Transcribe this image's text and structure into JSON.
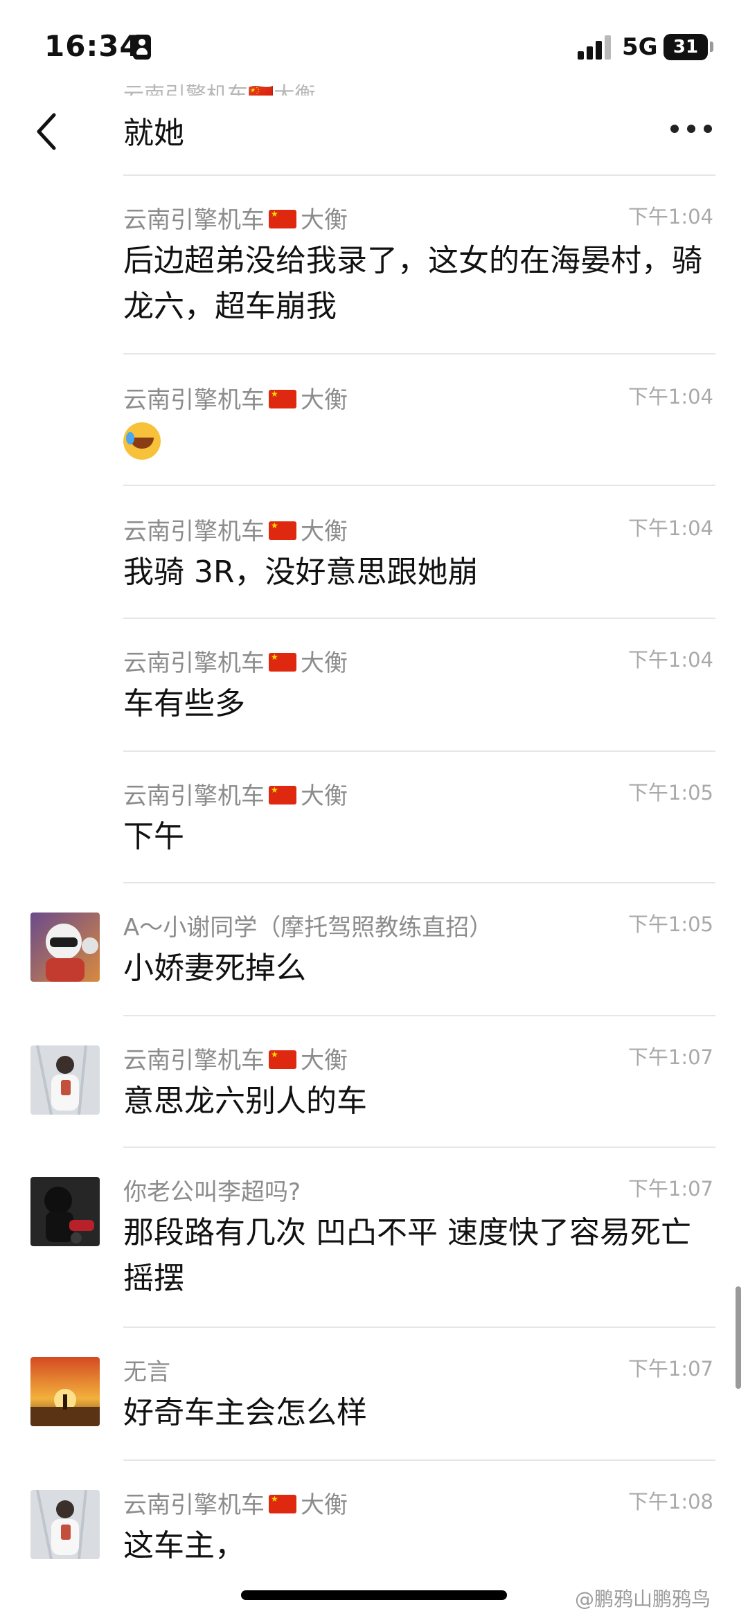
{
  "status_bar": {
    "time": "16:34",
    "network": "5G",
    "battery": "31",
    "icons": [
      "person-badge-icon",
      "signal-icon",
      "battery-icon"
    ]
  },
  "header": {
    "partial_previous": "云南引擎机车🇨🇳大衡",
    "title": "就她",
    "back_icon": "chevron-left-icon",
    "more_icon": "more-horizontal-icon"
  },
  "messages": [
    {
      "sender": "云南引擎机车",
      "sender_suffix": "大衡",
      "flag": true,
      "time": "下午1:04",
      "text": "后边超弟没给我录了，这女的在海晏村，骑龙六，超车崩我"
    },
    {
      "sender": "云南引擎机车",
      "sender_suffix": "大衡",
      "flag": true,
      "time": "下午1:04",
      "emoji": "loudly-crying-laughing-face"
    },
    {
      "sender": "云南引擎机车",
      "sender_suffix": "大衡",
      "flag": true,
      "time": "下午1:04",
      "text": "我骑 3R，没好意思跟她崩"
    },
    {
      "sender": "云南引擎机车",
      "sender_suffix": "大衡",
      "flag": true,
      "time": "下午1:04",
      "text": "车有些多"
    },
    {
      "sender": "云南引擎机车",
      "sender_suffix": "大衡",
      "flag": true,
      "time": "下午1:05",
      "text": "下午"
    },
    {
      "sender": "A～小谢同学（摩托驾照教练直招）",
      "time": "下午1:05",
      "text": "小娇妻死掉么",
      "avatar": "helmet-rider"
    },
    {
      "sender": "云南引擎机车",
      "sender_suffix": "大衡",
      "flag": true,
      "time": "下午1:07",
      "text": "意思龙六别人的车",
      "avatar": "person-white"
    },
    {
      "sender": "你老公叫李超吗?",
      "time": "下午1:07",
      "text": "那段路有几次 凹凸不平 速度快了容易死亡摇摆",
      "avatar": "dark-motorcycle"
    },
    {
      "sender": "无言",
      "time": "下午1:07",
      "text": "好奇车主会怎么样",
      "avatar": "sunset"
    },
    {
      "sender": "云南引擎机车",
      "sender_suffix": "大衡",
      "flag": true,
      "time": "下午1:08",
      "text": "这车主，",
      "avatar": "person-white"
    }
  ],
  "watermark": "@鹏鸦山鹏鸦鸟"
}
